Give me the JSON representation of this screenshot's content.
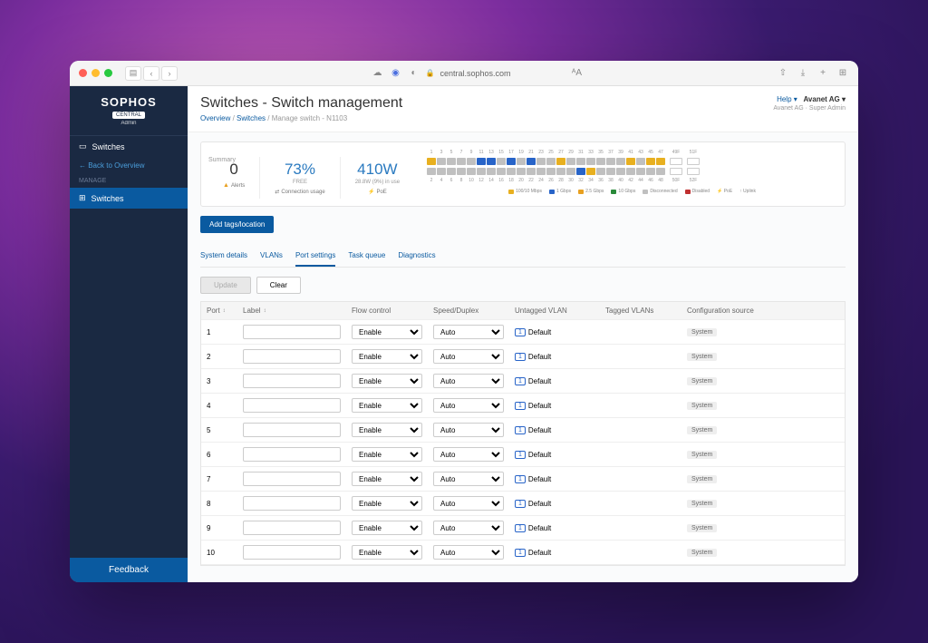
{
  "browser": {
    "url": "central.sophos.com",
    "lock": "🔒"
  },
  "brand": {
    "name": "SOPHOS",
    "badge": "CENTRAL",
    "sub": "Admin"
  },
  "sidebar": {
    "switches": "Switches",
    "back": "← Back to Overview",
    "manage_hdr": "MANAGE",
    "manage_item": "Switches"
  },
  "header": {
    "title": "Switches - Switch management",
    "crumb1": "Overview",
    "crumb2": "Switches",
    "crumb3": "Manage switch - N1103",
    "sep": " / ",
    "help": "Help ▾",
    "org": "Avanet AG ▾",
    "sub1": "Avanet AG",
    "sub2": "Super Admin"
  },
  "summary": {
    "label": "Summary",
    "alerts": {
      "val": "0",
      "lbl": "Alerts"
    },
    "conn": {
      "val": "73%",
      "sub": "FREE",
      "lbl": "Connection usage"
    },
    "poe": {
      "val": "410W",
      "sub": "28.8W (9%) in use",
      "lbl": "PoE"
    }
  },
  "port_nums_top": [
    "1",
    "3",
    "5",
    "7",
    "9",
    "11",
    "13",
    "15",
    "17",
    "19",
    "21",
    "23",
    "25",
    "27",
    "29",
    "31",
    "33",
    "35",
    "37",
    "39",
    "41",
    "43",
    "45",
    "47"
  ],
  "port_nums_bot": [
    "2",
    "4",
    "6",
    "8",
    "10",
    "12",
    "14",
    "16",
    "18",
    "20",
    "22",
    "24",
    "26",
    "28",
    "30",
    "32",
    "34",
    "36",
    "38",
    "40",
    "42",
    "44",
    "46",
    "48"
  ],
  "port_state_top": [
    "yellow",
    "gray",
    "gray",
    "gray",
    "gray",
    "blue",
    "blue",
    "gray",
    "blue",
    "gray",
    "blue",
    "gray",
    "gray",
    "yellow",
    "gray",
    "gray",
    "gray",
    "gray",
    "gray",
    "gray",
    "yellow",
    "gray",
    "yellow",
    "yellow"
  ],
  "port_state_bot": [
    "gray",
    "gray",
    "gray",
    "gray",
    "gray",
    "gray",
    "gray",
    "gray",
    "gray",
    "gray",
    "gray",
    "gray",
    "gray",
    "gray",
    "gray",
    "blue",
    "yellow",
    "gray",
    "gray",
    "gray",
    "gray",
    "gray",
    "gray",
    "gray"
  ],
  "sfp": {
    "top": [
      "49F",
      "51F"
    ],
    "bot": [
      "50F",
      "52F"
    ]
  },
  "legend": [
    {
      "c": "#e8b020",
      "t": "100/10 Mbps"
    },
    {
      "c": "#2864c8",
      "t": "1 Gbps"
    },
    {
      "c": "#e8a020",
      "t": "2.5 Gbps"
    },
    {
      "c": "#2a8a3a",
      "t": "10 Gbps"
    },
    {
      "c": "#c0c0c0",
      "t": "Disconnected"
    },
    {
      "c": "#c03030",
      "t": "Disabled"
    },
    {
      "c": "",
      "t": "⚡ PoE"
    },
    {
      "c": "",
      "t": "↑ Uplink"
    }
  ],
  "tags_btn": "Add tags/location",
  "tabs": [
    "System details",
    "VLANs",
    "Port settings",
    "Task queue",
    "Diagnostics"
  ],
  "active_tab": 2,
  "actions": {
    "update": "Update",
    "clear": "Clear"
  },
  "cols": {
    "port": "Port",
    "label": "Label",
    "flow": "Flow control",
    "speed": "Speed/Duplex",
    "uvlan": "Untagged VLAN",
    "tvlan": "Tagged VLANs",
    "conf": "Configuration source"
  },
  "flow_opts": [
    "Enable"
  ],
  "speed_opts": [
    "Auto"
  ],
  "rows": [
    {
      "port": "1",
      "label": "",
      "flow": "Enable",
      "speed": "Auto",
      "uvlan_id": "1",
      "uvlan_name": "Default",
      "tvlan": "",
      "conf": "System"
    },
    {
      "port": "2",
      "label": "",
      "flow": "Enable",
      "speed": "Auto",
      "uvlan_id": "1",
      "uvlan_name": "Default",
      "tvlan": "",
      "conf": "System"
    },
    {
      "port": "3",
      "label": "",
      "flow": "Enable",
      "speed": "Auto",
      "uvlan_id": "1",
      "uvlan_name": "Default",
      "tvlan": "",
      "conf": "System"
    },
    {
      "port": "4",
      "label": "",
      "flow": "Enable",
      "speed": "Auto",
      "uvlan_id": "1",
      "uvlan_name": "Default",
      "tvlan": "",
      "conf": "System"
    },
    {
      "port": "5",
      "label": "",
      "flow": "Enable",
      "speed": "Auto",
      "uvlan_id": "1",
      "uvlan_name": "Default",
      "tvlan": "",
      "conf": "System"
    },
    {
      "port": "6",
      "label": "",
      "flow": "Enable",
      "speed": "Auto",
      "uvlan_id": "1",
      "uvlan_name": "Default",
      "tvlan": "",
      "conf": "System"
    },
    {
      "port": "7",
      "label": "",
      "flow": "Enable",
      "speed": "Auto",
      "uvlan_id": "1",
      "uvlan_name": "Default",
      "tvlan": "",
      "conf": "System"
    },
    {
      "port": "8",
      "label": "",
      "flow": "Enable",
      "speed": "Auto",
      "uvlan_id": "1",
      "uvlan_name": "Default",
      "tvlan": "",
      "conf": "System"
    },
    {
      "port": "9",
      "label": "",
      "flow": "Enable",
      "speed": "Auto",
      "uvlan_id": "1",
      "uvlan_name": "Default",
      "tvlan": "",
      "conf": "System"
    },
    {
      "port": "10",
      "label": "",
      "flow": "Enable",
      "speed": "Auto",
      "uvlan_id": "1",
      "uvlan_name": "Default",
      "tvlan": "",
      "conf": "System"
    }
  ],
  "feedback": "Feedback"
}
